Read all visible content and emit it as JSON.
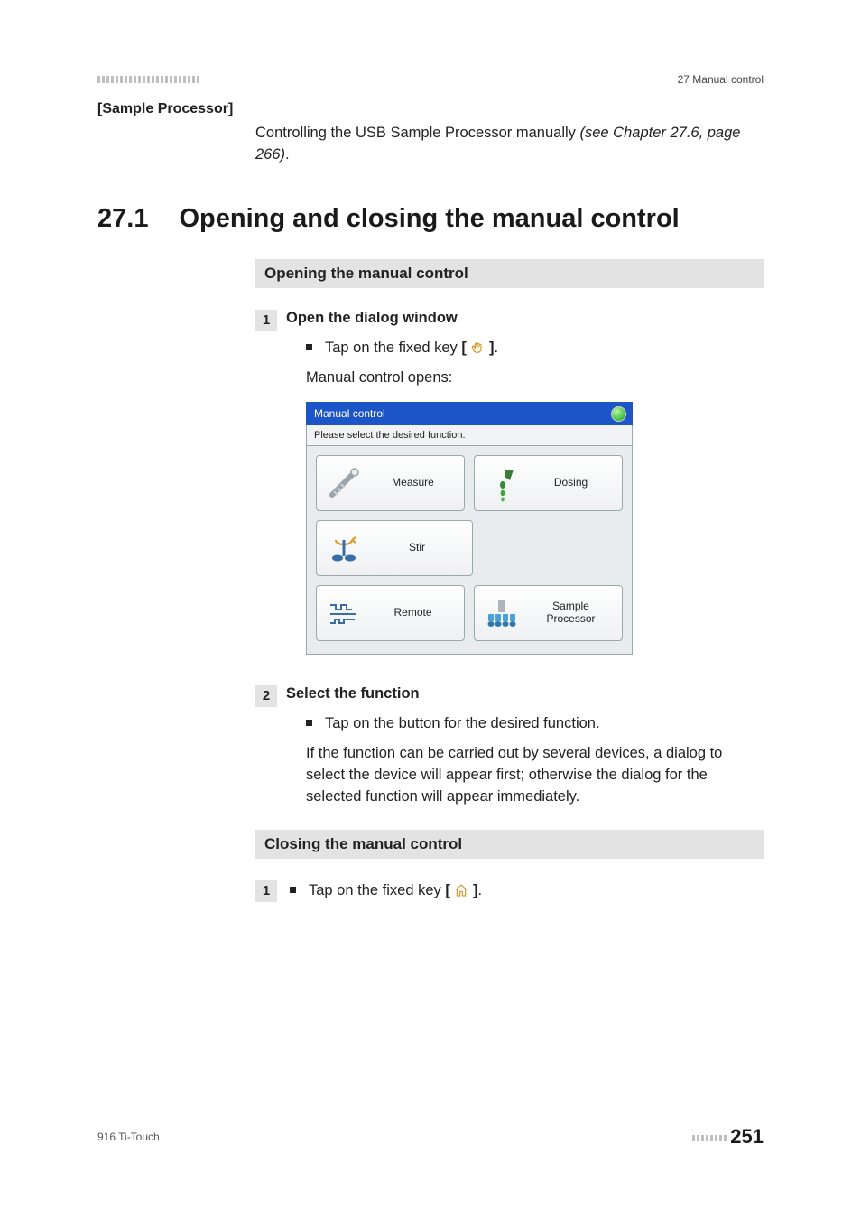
{
  "header": {
    "right": "27 Manual control"
  },
  "term": {
    "label": "[Sample Processor]"
  },
  "term_body": {
    "main": "Controlling the USB Sample Processor manually ",
    "italic": "(see Chapter 27.6, page 266)",
    "tail": "."
  },
  "section": {
    "num": "27.1",
    "title": "Opening and closing the manual control"
  },
  "proc1": {
    "bar": "Opening the manual control",
    "step1": {
      "num": "1",
      "title": "Open the dialog window",
      "bullet": {
        "pre": "Tap on the fixed key ",
        "key_open": "[ ",
        "key_close": " ]",
        "post": "."
      },
      "result": "Manual control opens:"
    },
    "step2": {
      "num": "2",
      "title": "Select the function",
      "bullet": "Tap on the button for the desired function.",
      "result": "If the function can be carried out by several devices, a dialog to select the device will appear first; otherwise the dialog for the selected function will appear immediately."
    }
  },
  "screenshot": {
    "title": "Manual control",
    "instruction": "Please select the desired function.",
    "buttons": {
      "measure": "Measure",
      "dosing": "Dosing",
      "stir": "Stir",
      "remote": "Remote",
      "sample": "Sample\nProcessor"
    }
  },
  "proc2": {
    "bar": "Closing the manual control",
    "step1": {
      "num": "1",
      "bullet": {
        "pre": "Tap on the fixed key ",
        "key_open": "[ ",
        "key_close": " ]",
        "post": "."
      }
    }
  },
  "footer": {
    "left": "916 Ti-Touch",
    "pagenum": "251"
  }
}
